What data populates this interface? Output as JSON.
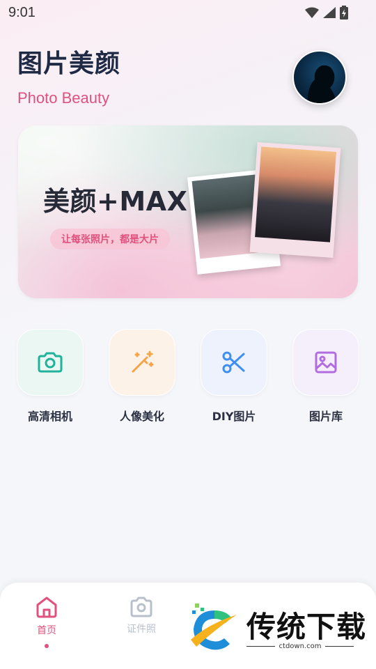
{
  "status": {
    "time": "9:01"
  },
  "header": {
    "title": "图片美颜",
    "subtitle": "Photo Beauty"
  },
  "banner": {
    "title": "美颜+MAX",
    "tagline": "让每张照片，都是大片"
  },
  "features": [
    {
      "label": "高清相机",
      "icon": "camera-icon",
      "color": "#1fb39a"
    },
    {
      "label": "人像美化",
      "icon": "magic-wand-icon",
      "color": "#f4a54a"
    },
    {
      "label": "DIY图片",
      "icon": "scissors-icon",
      "color": "#3f8ff0"
    },
    {
      "label": "图片库",
      "icon": "image-icon",
      "color": "#b36be0"
    }
  ],
  "bottom_nav": {
    "items": [
      {
        "label": "首页",
        "icon": "home-icon",
        "active": true
      },
      {
        "label": "证件照",
        "icon": "camera-icon",
        "active": false
      }
    ]
  },
  "watermark": {
    "text": "传统下载",
    "url": "ctdown.com"
  },
  "colors": {
    "accent": "#e0527e",
    "title": "#1f2a44",
    "inactive": "#b9c0cc"
  }
}
